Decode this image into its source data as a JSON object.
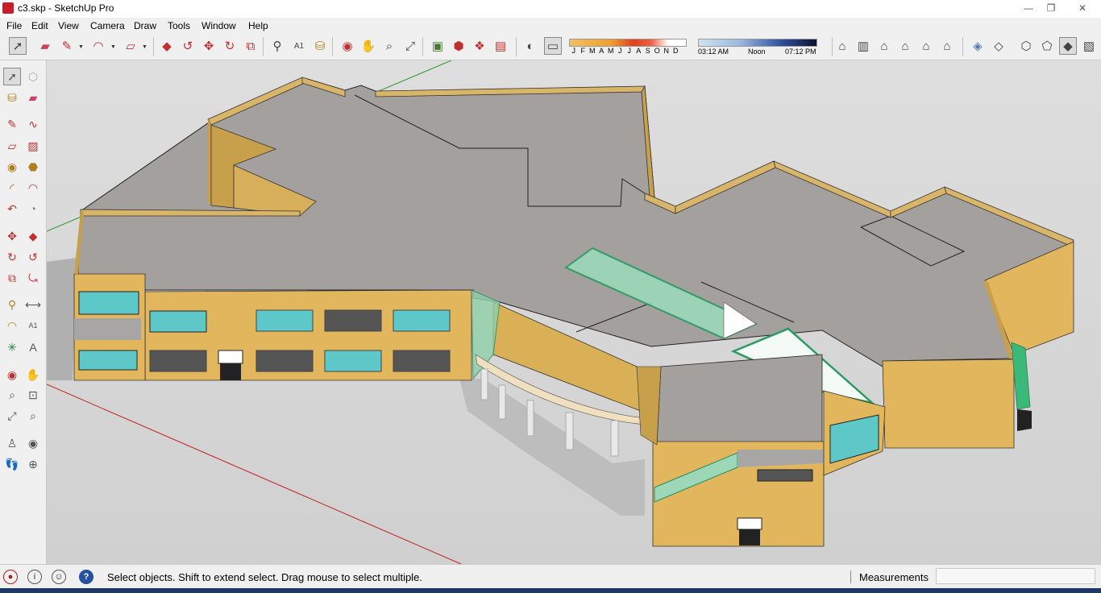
{
  "window": {
    "title": "c3.skp - SketchUp Pro",
    "controls": {
      "minimize": "—",
      "maximize": "❐",
      "close": "✕"
    }
  },
  "menu": [
    "File",
    "Edit",
    "View",
    "Camera",
    "Draw",
    "Tools",
    "Window",
    "Help"
  ],
  "toolbar": {
    "tools": [
      {
        "name": "select-tool",
        "icon": "arrow-icon",
        "selected": true
      },
      {
        "name": "eraser-tool",
        "icon": "eraser-icon"
      },
      {
        "name": "line-tool",
        "icon": "pencil-icon"
      },
      {
        "name": "arc-tool",
        "icon": "arc-icon"
      },
      {
        "name": "rectangle-tool",
        "icon": "rectangle-icon"
      },
      {
        "name": "push-pull-tool",
        "icon": "push-pull-icon"
      },
      {
        "name": "follow-me-tool",
        "icon": "follow-me-icon"
      },
      {
        "name": "move-tool",
        "icon": "move-icon"
      },
      {
        "name": "rotate-tool",
        "icon": "rotate-icon"
      },
      {
        "name": "scale-tool",
        "icon": "scale-icon"
      },
      {
        "name": "tape-measure-tool",
        "icon": "tape-icon"
      },
      {
        "name": "text-tool",
        "icon": "text-icon"
      },
      {
        "name": "paint-bucket-tool",
        "icon": "paint-bucket-icon"
      },
      {
        "name": "orbit-tool",
        "icon": "orbit-icon"
      },
      {
        "name": "pan-tool",
        "icon": "hand-icon"
      },
      {
        "name": "zoom-tool",
        "icon": "magnifier-icon"
      },
      {
        "name": "zoom-extents-tool",
        "icon": "zoom-extents-icon"
      },
      {
        "name": "get-models-tool",
        "icon": "warehouse-icon"
      },
      {
        "name": "share-model-tool",
        "icon": "share-icon"
      },
      {
        "name": "share-component-tool",
        "icon": "component-icon"
      },
      {
        "name": "extension-warehouse-tool",
        "icon": "extension-icon"
      },
      {
        "name": "shadows-toggle",
        "icon": "shadow-icon"
      },
      {
        "name": "fog-toggle",
        "icon": "fog-icon",
        "selected": true
      }
    ],
    "shadow_months": [
      "J",
      "F",
      "M",
      "A",
      "M",
      "J",
      "J",
      "A",
      "S",
      "O",
      "N",
      "D"
    ],
    "shadow_time_start": "03:12 AM",
    "shadow_time_mid": "Noon",
    "shadow_time_end": "07:12 PM",
    "views": [
      {
        "name": "iso-view",
        "icon": "iso-icon"
      },
      {
        "name": "top-view",
        "icon": "top-icon"
      },
      {
        "name": "front-view",
        "icon": "front-icon"
      },
      {
        "name": "right-view",
        "icon": "right-icon"
      },
      {
        "name": "back-view",
        "icon": "back-icon"
      },
      {
        "name": "left-view",
        "icon": "left-icon"
      }
    ],
    "styles": [
      {
        "name": "xray-style",
        "icon": "xray-icon"
      },
      {
        "name": "back-edges-style",
        "icon": "back-edges-icon"
      },
      {
        "name": "wireframe-style",
        "icon": "wireframe-icon"
      },
      {
        "name": "hidden-line-style",
        "icon": "hidden-line-icon"
      },
      {
        "name": "shaded-style",
        "icon": "shaded-icon",
        "selected": true
      },
      {
        "name": "shaded-textures-style",
        "icon": "shaded-textures-icon"
      }
    ]
  },
  "left_toolbar": [
    [
      "select",
      "component"
    ],
    [
      "paint",
      "eraser"
    ],
    [
      "line",
      "freehand"
    ],
    [
      "rectangle",
      "rotated-rectangle"
    ],
    [
      "circle",
      "polygon"
    ],
    [
      "arc",
      "two-point-arc"
    ],
    [
      "three-point-arc",
      "pie"
    ],
    [
      "move",
      "push-pull"
    ],
    [
      "rotate",
      "follow-me"
    ],
    [
      "scale",
      "offset"
    ],
    [
      "tape-measure",
      "dimension"
    ],
    [
      "protractor",
      "text"
    ],
    [
      "axes",
      "3d-text"
    ],
    [
      "orbit",
      "pan"
    ],
    [
      "zoom",
      "zoom-window"
    ],
    [
      "zoom-extents",
      "previous"
    ],
    [
      "position-camera",
      "look-around"
    ],
    [
      "walk",
      "section-plane"
    ]
  ],
  "statusbar": {
    "message": "Select objects. Shift to extend select. Drag mouse to select multiple.",
    "measurements_label": "Measurements",
    "measurements_value": ""
  },
  "colors": {
    "sky": "#d8d8d8",
    "ground": "#cfcfcf",
    "wall": "#e2b65c",
    "wall_dark": "#c8a04c",
    "roof": "#a09d9b",
    "glass": "#5ec8c8",
    "skylight": "#9cd8b8",
    "parapet": "#d9b56a"
  }
}
